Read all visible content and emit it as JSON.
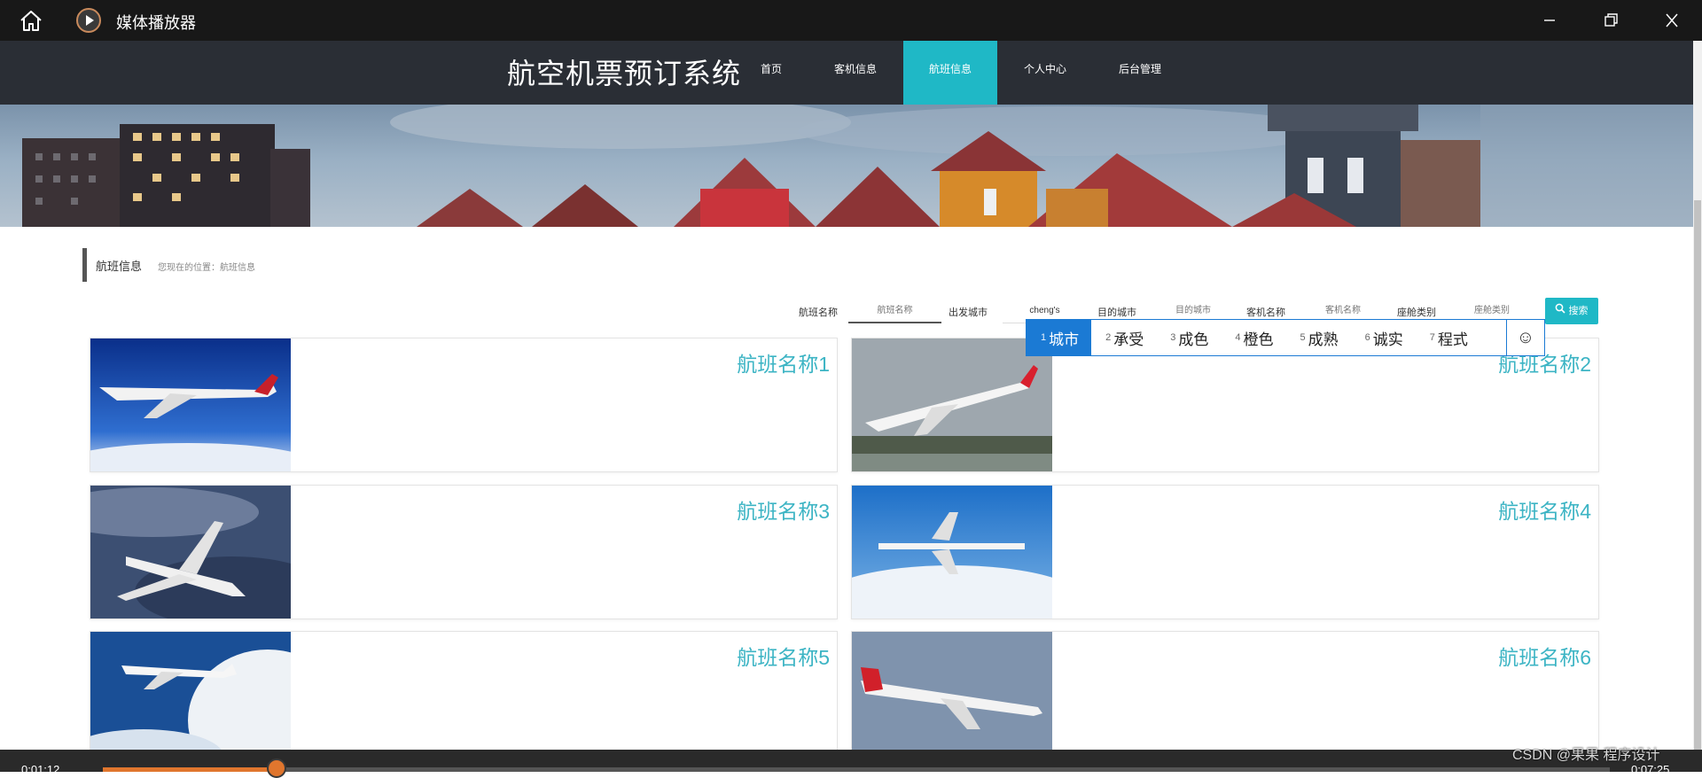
{
  "window": {
    "app_title": "媒体播放器",
    "icons": {
      "home": "home-icon",
      "app": "play-circle-icon",
      "minimize": "minimize-icon",
      "maximize": "maximize-icon",
      "close": "close-icon"
    }
  },
  "site": {
    "brand": "航空机票预订系统",
    "nav": [
      {
        "label": "首页",
        "active": false
      },
      {
        "label": "客机信息",
        "active": false
      },
      {
        "label": "航班信息",
        "active": true
      },
      {
        "label": "个人中心",
        "active": false
      },
      {
        "label": "后台管理",
        "active": false
      }
    ],
    "accent_color": "#1fb8c6"
  },
  "breadcrumb": {
    "title": "航班信息",
    "location": "您现在的位置：航班信息"
  },
  "search": {
    "fields": [
      {
        "label": "航班名称",
        "value": "",
        "placeholder": "航班名称"
      },
      {
        "label": "出发城市",
        "value": "cheng's",
        "placeholder": "出发城市"
      },
      {
        "label": "目的城市",
        "value": "",
        "placeholder": "目的城市"
      },
      {
        "label": "客机名称",
        "value": "",
        "placeholder": "客机名称"
      },
      {
        "label": "座舱类别",
        "value": "",
        "placeholder": "座舱类别"
      }
    ],
    "button_label": "搜索",
    "button_icon": "search-icon"
  },
  "ime": {
    "candidates": [
      {
        "num": "1",
        "text": "城市",
        "selected": true
      },
      {
        "num": "2",
        "text": "承受",
        "selected": false
      },
      {
        "num": "3",
        "text": "成色",
        "selected": false
      },
      {
        "num": "4",
        "text": "橙色",
        "selected": false
      },
      {
        "num": "5",
        "text": "成熟",
        "selected": false
      },
      {
        "num": "6",
        "text": "诚实",
        "selected": false
      },
      {
        "num": "7",
        "text": "程式",
        "selected": false
      }
    ],
    "emoji_icon": "smiley-icon",
    "emoji_glyph": "☺"
  },
  "flights": [
    {
      "title": "航班名称1",
      "image": "airplane-photo"
    },
    {
      "title": "航班名称2",
      "image": "airplane-photo"
    },
    {
      "title": "航班名称3",
      "image": "airplane-photo"
    },
    {
      "title": "航班名称4",
      "image": "airplane-photo"
    },
    {
      "title": "航班名称5",
      "image": "airplane-photo"
    },
    {
      "title": "航班名称6",
      "image": "airplane-photo"
    }
  ],
  "player": {
    "elapsed": "0:01:12",
    "total": "0:07:25",
    "progress_fraction": 0.115
  },
  "watermark": "CSDN @果果 程序设计"
}
